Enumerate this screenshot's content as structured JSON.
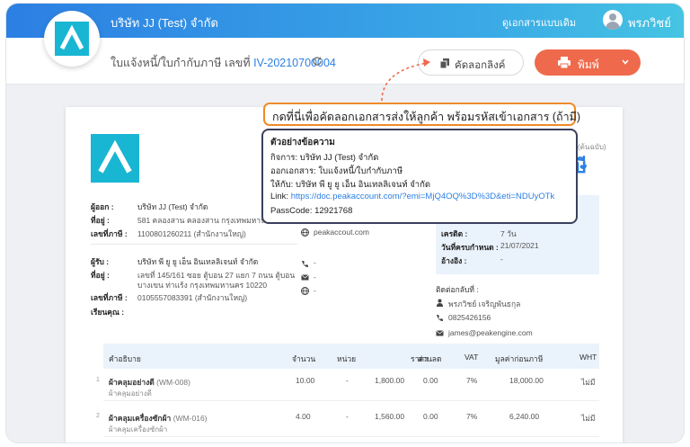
{
  "topbar": {
    "company": "บริษัท JJ (Test) จำกัด",
    "old_view": "ดูเอกสารแบบเดิม",
    "user_name": "พรภวิชย์"
  },
  "subbar": {
    "doc_title_prefix": "ใบแจ้งหนี้/ใบกำกับภาษี เลขที่",
    "doc_number": "IV-20210700004",
    "copy_link_label": "คัดลอกลิงค์",
    "print_label": "พิมพ์"
  },
  "callout": "กดที่นี่เพื่อคัดลอกเอกสารส่งให้ลูกค้า พร้อมรหัสเข้าเอกสาร (ถ้ามี)",
  "example": {
    "title": "ตัวอย่างข้อความ",
    "line1": "กิจการ: บริษัท JJ (Test)  จำกัด",
    "line2": "ออกเอกสาร: ใบแจ้งหนี้/ใบกำกับภาษี",
    "line3": "ให้กับ: บริษัท พี ยู ยู เอ็น อินเทลลิเจนท์ จำกัด",
    "link_label": "Link: ",
    "link_url": "https://doc.peakaccount.com/?emi=MjQ4OQ%3D%3D&eti=NDUyOTk",
    "passcode": "PassCode: 12921768"
  },
  "paper": {
    "doc_type_small": "(ต้นฉบับ)",
    "doc_type_big": "ษี",
    "issuer": {
      "label_issuer": "ผู้ออก :",
      "issuer_name": "บริษัท JJ (Test) จำกัด",
      "label_address": "ที่อยู่ :",
      "address": "581 คลองสาน คลองสาน กรุงเทพมหาน",
      "label_tax": "เลขที่ภาษี :",
      "tax": "1100801260211 (สำนักงานใหญ่)",
      "web": "peakaccout.com"
    },
    "customer": {
      "label_receiver": "ผู้รับ :",
      "name": "บริษัท พี ยู ยู เอ็น อินเทลลิเจนท์ จำกัด",
      "label_address": "ที่อยู่ :",
      "address1": "เลขที่ 145/161 ซอย ตู้บอน 27 แยก 7 ถนน ตู้บอน",
      "address2": "บางเขน ท่าแร้ง กรุงเทพมหานคร 10220",
      "label_tax": "เลขที่ภาษี :",
      "tax": "0105557083391 (สำนักงานใหญ่)",
      "label_attn": "เรียนคุณ :",
      "phone": "-",
      "email": "-",
      "web": "-"
    },
    "terms": {
      "label_credit": "เครดิต :",
      "credit": "7 วัน",
      "label_due": "วันที่ครบกำหนด :",
      "due": "21/07/2021",
      "label_ref": "อ้างอิง :",
      "ref": "-"
    },
    "contact": {
      "label": "ติดต่อกลับที่ :",
      "name": "พรภวิชย์ เจริญพันธกุล",
      "phone": "0825426156",
      "email": "james@peakengine.com"
    },
    "table": {
      "headers": [
        "คำอธิบาย",
        "จำนวน",
        "หน่วย",
        "ราคา",
        "ส่วนลด",
        "VAT",
        "มูลค่าก่อนภาษี",
        "WHT"
      ],
      "rows": [
        {
          "no": "1",
          "name": "ผ้าคลุมอย่างดี",
          "code": "(WM-008)",
          "sub": "ผ้าคลุมอย่างดี",
          "qty": "10.00",
          "unit": "-",
          "price": "1,800.00",
          "discount": "0.00",
          "vat": "7%",
          "amount": "18,000.00",
          "wht": "ไม่มี"
        },
        {
          "no": "2",
          "name": "ผ้าคลุมเครื่องซักผ้า",
          "code": "(WM-016)",
          "sub": "ผ้าคลุมเครื่องซักผ้า",
          "qty": "4.00",
          "unit": "-",
          "price": "1,560.00",
          "discount": "0.00",
          "vat": "7%",
          "amount": "6,240.00",
          "wht": "ไม่มี"
        }
      ]
    }
  },
  "colors": {
    "accent": "#2c7fe3",
    "print": "#ef6a4c",
    "callout_border": "#ef8a2a",
    "logo": "#19b6d3"
  }
}
